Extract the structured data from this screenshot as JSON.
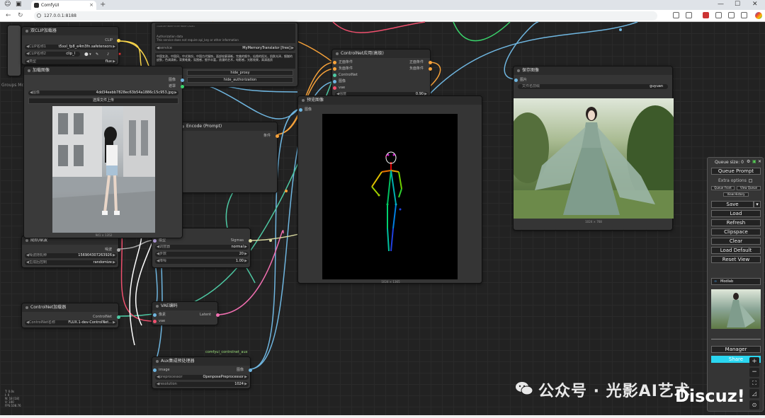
{
  "browser": {
    "tab_title": "ComfyUI",
    "url": "127.0.0.1:8188",
    "new_tab": "+",
    "minimize": "—",
    "maximize": "☐",
    "close": "✕"
  },
  "nodes": {
    "dual_clip": {
      "title": "双CLIP加载器",
      "output": "CLIP",
      "clip1_label": "CLIP名称1",
      "clip1_value": "t5xxl_fp8_e4m3fn.safetensors",
      "clip2_label": "CLIP名称2",
      "clip2_value": "clip_l",
      "type_label": "类型",
      "type_value": "flux"
    },
    "translator": {
      "line1": "<sub>ID 'dbCh'=1 ID 'dbCh'</sub>",
      "line2": "Authorization data",
      "line3": "This service does not require api_key or other information",
      "service_label": "service",
      "service_value": "MyMemoryTranslator [free]",
      "prompt_text": "中国女孩，中国风，中式装扮，中国古代服饰，面部轮廓清晰，完美的细节，仙隐的阳光，肌肤光泽，细腻的皮肤，色调清新，背景唯美，氛围感，细节丰富，浪漫的艺术，电影感，光影效果，高清画质",
      "hide_proxy": "hide_proxy",
      "hide_auth": "hide_authorization"
    },
    "controlnet_apply": {
      "title": "ControlNet应用(高级)",
      "in1": "正面条件",
      "in2": "负面条件",
      "in3": "ControlNet",
      "in4": "图像",
      "in5": "vae",
      "out1": "正面条件",
      "out2": "负面条件",
      "strength_label": "强度",
      "strength_value": "0.90"
    },
    "load_image": {
      "title": "加载图像",
      "out1": "图像",
      "out2": "遮罩",
      "image_label": "图像",
      "image_value": "4dd34eebb7828ec63b54a1886c15c953.jpg",
      "upload": "选择文件上传",
      "dims": "941 × 1352"
    },
    "clip_encode": {
      "title": "Encode (Prompt)",
      "out": "条件"
    },
    "preview": {
      "title": "预览图像",
      "in": "图像",
      "dims": "1024 × 1365"
    },
    "save": {
      "title": "保存图像",
      "in": "图片",
      "prefix_label": "文件名前缀",
      "prefix_value": "guyuan",
      "dims": "1024 × 768"
    },
    "noise": {
      "title": "随机噪波",
      "out": "噪波",
      "seed_label": "噪波随机种",
      "seed_value": "156904307263926",
      "ctrl_label": "生成后控制",
      "ctrl_value": "randomize"
    },
    "scheduler": {
      "in": "模型",
      "out": "Sigmas",
      "sched_label": "调度器",
      "sched_value": "normal",
      "steps_label": "步数",
      "steps_value": "20",
      "denoise_label": "降噪",
      "denoise_value": "1.00"
    },
    "cn_loader": {
      "title": "ControlNet加载器",
      "out": "ControlNet",
      "name_label": "ControlNet名称",
      "name_value": "FLUX.1-dev-ControlNet..."
    },
    "vae_encode": {
      "title": "VAE编码",
      "in1": "像素",
      "in2": "vae",
      "out": "Latent"
    },
    "aux": {
      "group": "comfyui_controlnet_aux",
      "title": "Aux集成预处理器",
      "in": "image",
      "out": "图像",
      "pre_label": "preprocessor",
      "pre_value": "OpenposePreprocessor",
      "res_label": "resolution",
      "res_value": "1024"
    },
    "groups_label": "Groups Mo"
  },
  "menu": {
    "queue_size": "Queue size: 0",
    "queue_prompt": "Queue Prompt",
    "extra_options": "Extra options",
    "queue_front": "Queue Front",
    "view_queue": "View Queue",
    "view_history": "View History",
    "save": "Save",
    "load": "Load",
    "refresh": "Refresh",
    "clipspace": "Clipspace",
    "clear": "Clear",
    "load_default": "Load Default",
    "reset_view": "Reset View",
    "modlab": "Modlab",
    "manager": "Manager",
    "share": "Share"
  },
  "zoom_controls": [
    "+",
    "−",
    "⛶",
    "◿",
    "⊙"
  ],
  "stats": [
    "T: 0.0s",
    "I: 0",
    "N: 18 [18]",
    "V: 100",
    "FPS:108.76"
  ],
  "watermark": {
    "text": "公众号 · 光影AI艺术",
    "discuz": "Discuz!"
  }
}
